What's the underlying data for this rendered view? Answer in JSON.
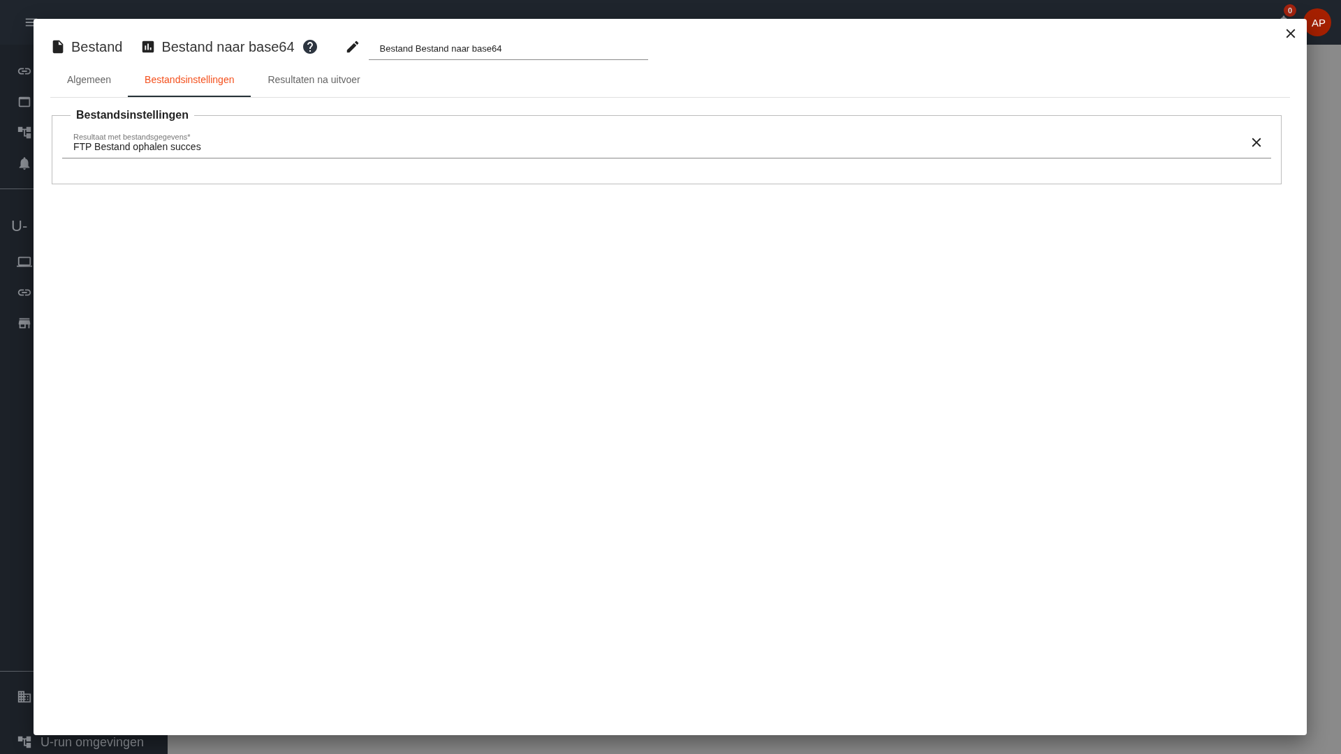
{
  "topbar": {
    "notification_count": "0",
    "avatar_initials": "AP"
  },
  "sidebar": {
    "section_title": "U-",
    "bottom_item_label": "U-run omgevingen"
  },
  "modal": {
    "breadcrumb": [
      {
        "kind": "file",
        "label": "Bestand"
      },
      {
        "kind": "chart",
        "label": "Bestand naar base64"
      }
    ],
    "name_field": {
      "value": "Bestand Bestand naar base64"
    },
    "tabs": [
      {
        "label": "Algemeen",
        "selected": false
      },
      {
        "label": "Bestandsinstellingen",
        "selected": true
      },
      {
        "label": "Resultaten na uitvoer",
        "selected": false
      }
    ],
    "section": {
      "legend": "Bestandsinstellingen",
      "field": {
        "label": "Resultaat met bestandsgegevens*",
        "value": "FTP Bestand ophalen succes"
      }
    }
  }
}
